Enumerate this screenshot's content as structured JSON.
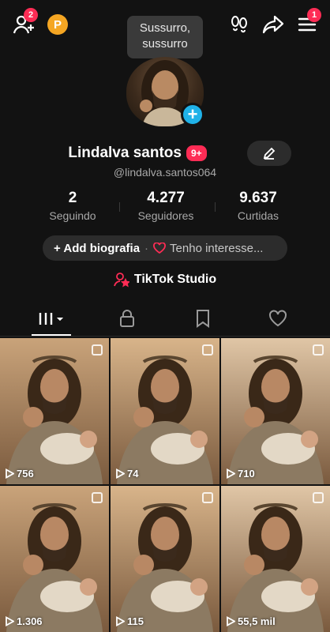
{
  "topbar": {
    "friends_badge": "2",
    "points_label": "P",
    "menu_badge": "1",
    "tooltip": "Sussurro,\nsussurro"
  },
  "profile": {
    "name": "Lindalva santos",
    "name_badge": "9+",
    "handle": "@lindalva.santos064"
  },
  "stats": [
    {
      "value": "2",
      "label": "Seguindo"
    },
    {
      "value": "4.277",
      "label": "Seguidores"
    },
    {
      "value": "9.637",
      "label": "Curtidas"
    }
  ],
  "bio": {
    "add_label": "+ Add biografia",
    "dot": "·",
    "interest_label": "Tenho interesse..."
  },
  "studio": {
    "label": "TikTok Studio"
  },
  "videos": [
    {
      "views": "756"
    },
    {
      "views": "74"
    },
    {
      "views": "710"
    },
    {
      "views": "1.306"
    },
    {
      "views": "115"
    },
    {
      "views": "55,5 mil"
    }
  ],
  "colors": {
    "accent": "#fe2c55",
    "background": "#121212",
    "plus": "#20b2e8"
  }
}
